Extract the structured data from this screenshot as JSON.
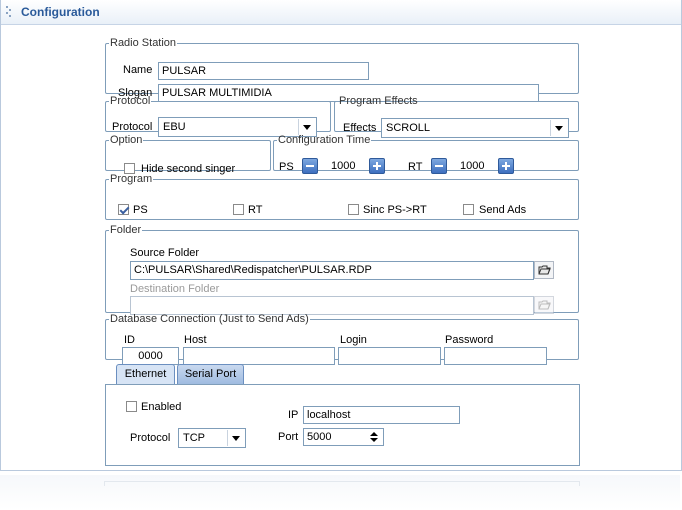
{
  "window": {
    "title": "Configuration"
  },
  "radio_station": {
    "legend": "Radio Station",
    "name_label": "Name",
    "name_value": "PULSAR",
    "slogan_label": "Slogan",
    "slogan_value": "PULSAR MULTIMIDIA"
  },
  "protocol": {
    "legend": "Protocol",
    "label": "Protocol",
    "value": "EBU"
  },
  "program_effects": {
    "legend": "Program Effects",
    "label": "Effects",
    "value": "SCROLL"
  },
  "option": {
    "legend": "Option",
    "hide_second_singer": "Hide second singer",
    "hide_second_singer_checked": false
  },
  "configuration_time": {
    "legend": "Configuration Time",
    "ps_label": "PS",
    "ps_value": "1000",
    "rt_label": "RT",
    "rt_value": "1000"
  },
  "program": {
    "legend": "Program",
    "ps_label": "PS",
    "ps_checked": true,
    "rt_label": "RT",
    "rt_checked": false,
    "sinc_label": "Sinc PS->RT",
    "sinc_checked": false,
    "send_ads_label": "Send Ads",
    "send_ads_checked": false
  },
  "folder": {
    "legend": "Folder",
    "source_label": "Source Folder",
    "source_value": "C:\\PULSAR\\Shared\\Redispatcher\\PULSAR.RDP",
    "destination_label": "Destination Folder",
    "destination_value": ""
  },
  "database": {
    "legend": "Database Connection (Just to Send Ads)",
    "id_label": "ID",
    "id_value": "0000",
    "host_label": "Host",
    "host_value": "",
    "login_label": "Login",
    "login_value": "",
    "password_label": "Password",
    "password_value": ""
  },
  "tabs": [
    {
      "label": "Ethernet",
      "active": true
    },
    {
      "label": "Serial Port",
      "active": false
    }
  ],
  "ethernet": {
    "enabled_label": "Enabled",
    "enabled_checked": false,
    "ip_label": "IP",
    "ip_value": "localhost",
    "protocol_label": "Protocol",
    "protocol_value": "TCP",
    "port_label": "Port",
    "port_value": "5000"
  },
  "icons": {
    "folder_open": "folder-open-icon",
    "dropdown_arrow": "chevron-down-icon",
    "minus": "minus-icon",
    "plus": "plus-icon"
  },
  "colors": {
    "title_text": "#2a5a9a",
    "group_border": "#7f9db9",
    "step_button": "#3d6fbf",
    "tab_active": "#d7e4f5"
  }
}
